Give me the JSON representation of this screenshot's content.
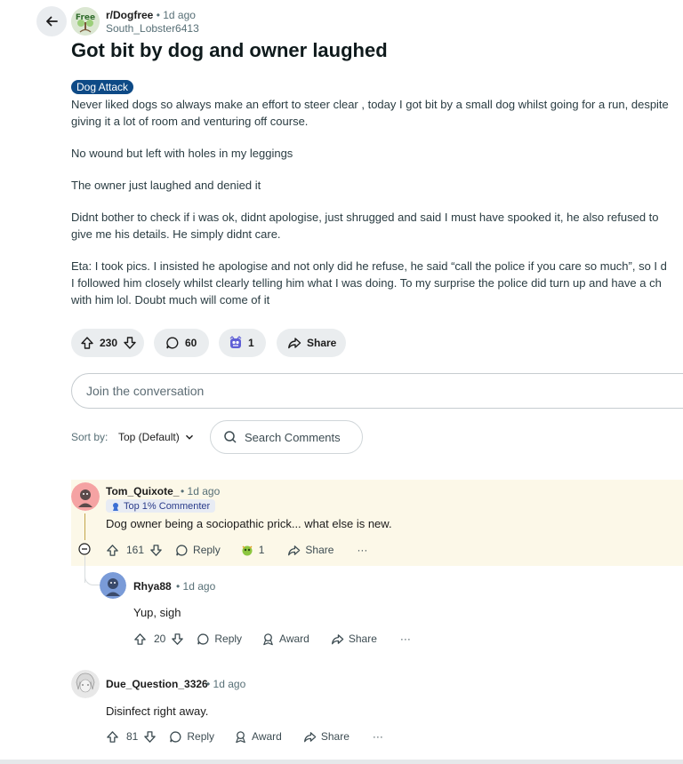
{
  "post": {
    "subreddit": "r/Dogfree",
    "subreddit_icon_text": "Free",
    "time": "1d ago",
    "author": "South_Lobster6413",
    "title": "Got bit by dog and owner laughed",
    "flair": "Dog Attack",
    "body": [
      "Never liked dogs so always make an effort to steer clear , today I got bit by a small dog whilst going for a run, despite\ngiving it a lot of room and venturing off course.",
      "No wound but left with holes in my leggings",
      "The owner just laughed and denied it",
      "Didnt bother to check if i was ok, didnt apologise, just shrugged and said I must have spooked it, he also refused to\ngive me his details. He simply didnt care.",
      "Eta: I took pics. I insisted he apologise and not only did he refuse, he said “call the police if you care so much”, so I d\nI followed him closely whilst clearly telling him what I was doing. To my surprise the police did turn up and have a ch\nwith him lol. Doubt much will come of it"
    ],
    "votes": "230",
    "comments": "60",
    "awards": "1",
    "share": "Share"
  },
  "join_placeholder": "Join the conversation",
  "sort": {
    "label": "Sort by:",
    "value": "Top (Default)"
  },
  "search_comments": "Search Comments",
  "comments": [
    {
      "author": "Tom_Quixote_",
      "time": "1d ago",
      "badge": "Top 1% Commenter",
      "text": "Dog owner being a sociopathic prick... what else is new.",
      "votes": "161",
      "reply": "Reply",
      "award_count": "1",
      "share": "Share",
      "more": "···"
    },
    {
      "author": "Rhya88",
      "time": "1d ago",
      "text": "Yup, sigh",
      "votes": "20",
      "reply": "Reply",
      "award": "Award",
      "share": "Share",
      "more": "···"
    },
    {
      "author": "Due_Question_3326",
      "time": "1d ago",
      "text": "Disinfect right away.",
      "votes": "81",
      "reply": "Reply",
      "award": "Award",
      "share": "Share",
      "more": "···"
    }
  ],
  "colors": {
    "flair_bg": "#0e4a86",
    "highlight_bg": "#fcf8e8",
    "pill_bg": "#eaedef",
    "thread_line": "#c3a64a"
  }
}
